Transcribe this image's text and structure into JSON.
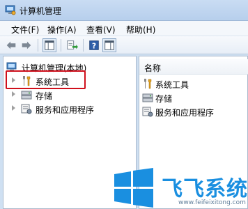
{
  "window": {
    "title": "计算机管理"
  },
  "menu": [
    "文件(F)",
    "操作(A)",
    "查看(V)",
    "帮助(H)"
  ],
  "toolbar": {
    "buttons": [
      "back-icon",
      "forward-icon",
      "show-hide-tree-icon",
      "export-list-icon",
      "help-icon",
      "properties-icon"
    ]
  },
  "tree": {
    "root": "计算机管理(本地)",
    "items": [
      {
        "label": "系统工具",
        "icon": "tools-icon",
        "selected": true
      },
      {
        "label": "存储",
        "icon": "storage-icon"
      },
      {
        "label": "服务和应用程序",
        "icon": "services-icon"
      }
    ]
  },
  "list": {
    "column": "名称",
    "items": [
      {
        "label": "系统工具",
        "icon": "tools-icon"
      },
      {
        "label": "存储",
        "icon": "storage-icon"
      },
      {
        "label": "服务和应用程序",
        "icon": "services-icon"
      }
    ]
  },
  "watermark": {
    "text": "飞飞系统",
    "url": "www.feifeixitong.com"
  },
  "colors": {
    "highlight": "#d0101c",
    "watermark": "#1a8fe0"
  }
}
